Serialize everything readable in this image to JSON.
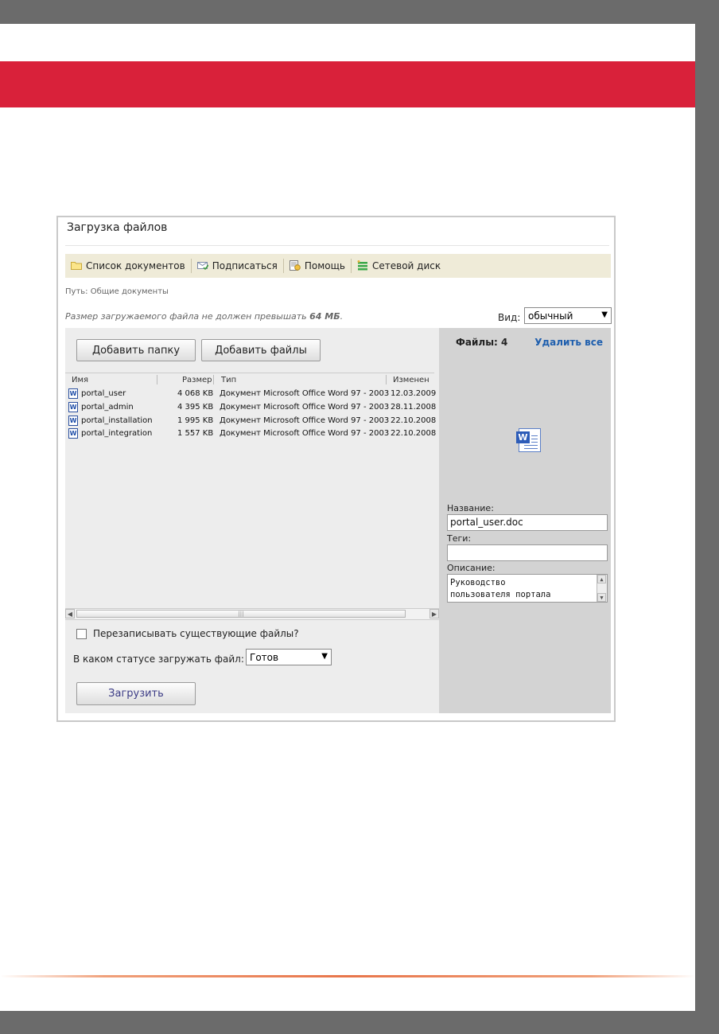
{
  "dialog": {
    "title": "Загрузка файлов",
    "toolbar": [
      {
        "label": "Список документов",
        "icon": "folder-icon"
      },
      {
        "label": "Подписаться",
        "icon": "subscribe-icon"
      },
      {
        "label": "Помощь",
        "icon": "help-icon"
      },
      {
        "label": "Сетевой диск",
        "icon": "network-drive-icon"
      }
    ],
    "path": "Путь: Общие документы",
    "size_warning_prefix": "Размер загружаемого файла не должен превышать ",
    "size_warning_value": "64 МБ",
    "size_warning_suffix": ".",
    "view_label": "Вид:",
    "view_value": "обычный",
    "buttons": {
      "add_folder": "Добавить папку",
      "add_files": "Добавить файлы",
      "upload": "Загрузить"
    },
    "grid": {
      "columns": [
        "Имя",
        "Размер",
        "Тип",
        "Изменен"
      ],
      "rows": [
        {
          "name": "portal_user",
          "size": "4 068 KB",
          "type": "Документ Microsoft Office Word 97 - 2003",
          "modified": "12.03.2009"
        },
        {
          "name": "portal_admin",
          "size": "4 395 KB",
          "type": "Документ Microsoft Office Word 97 - 2003",
          "modified": "28.11.2008"
        },
        {
          "name": "portal_installation",
          "size": "1 995 KB",
          "type": "Документ Microsoft Office Word 97 - 2003",
          "modified": "22.10.2008"
        },
        {
          "name": "portal_integration",
          "size": "1 557 KB",
          "type": "Документ Microsoft Office Word 97 - 2003",
          "modified": "22.10.2008"
        }
      ]
    },
    "overwrite_label": "Перезаписывать существующие файлы?",
    "status_label": "В каком статусе загружать файл:",
    "status_value": "Готов",
    "right": {
      "files_count": "Файлы: 4",
      "delete_all": "Удалить все",
      "name_label": "Название:",
      "name_value": "portal_user.doc",
      "tags_label": "Теги:",
      "tags_value": "",
      "desc_label": "Описание:",
      "desc_line1": "Руководство",
      "desc_line2": "пользователя портала"
    }
  },
  "colors": {
    "header_red": "#d9213a",
    "toolbar_bg": "#efebd8",
    "link_blue": "#1f5fae"
  }
}
